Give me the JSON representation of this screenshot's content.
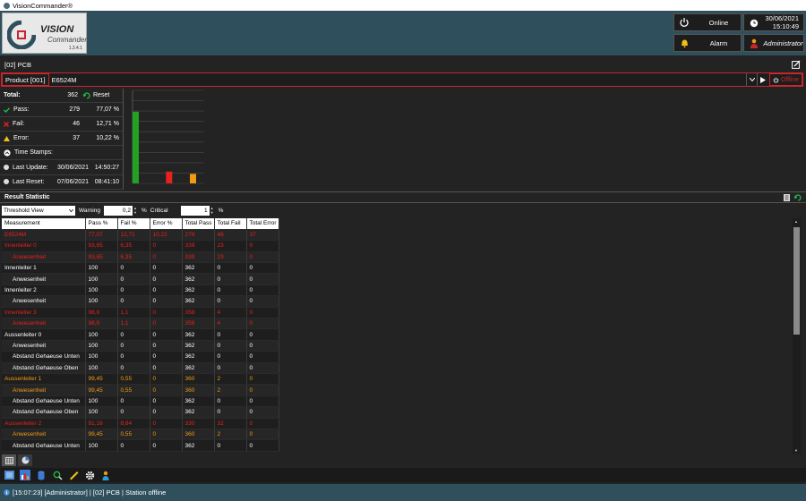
{
  "titlebar": {
    "title": "VisionCommander®"
  },
  "logo": {
    "line1": "VISION",
    "line2": "Commander",
    "version": "1.3.4.1"
  },
  "header": {
    "online_label": "Online",
    "alarm_label": "Alarm",
    "date": "30/06/2021",
    "time": "15:10:49",
    "user": "Administrator"
  },
  "toolbar": {
    "station": "[02] PCB"
  },
  "product": {
    "label": "Product [001]",
    "value": "E6524M",
    "offline_label": "Offline"
  },
  "stats": {
    "total_label": "Total:",
    "total_value": "362",
    "reset_label": "Reset",
    "pass_label": "Pass:",
    "pass_value": "279",
    "pass_pct": "77,07 %",
    "fail_label": "Fail:",
    "fail_value": "46",
    "fail_pct": "12,71 %",
    "error_label": "Error:",
    "error_value": "37",
    "error_pct": "10,22 %",
    "timestamps_label": "Time Stamps:",
    "last_update_label": "Last Update:",
    "last_update_date": "30/06/2021",
    "last_update_time": "14:50:27",
    "last_reset_label": "Last Reset:",
    "last_reset_date": "07/06/2021",
    "last_reset_time": "08:41:10"
  },
  "chart_data": {
    "type": "bar",
    "categories": [
      "Pass",
      "Fail",
      "Error"
    ],
    "values": [
      279,
      46,
      37
    ],
    "colors": [
      "#22a122",
      "#e8201e",
      "#f29b12"
    ],
    "ylim": [
      0,
      362
    ],
    "grid": true
  },
  "result": {
    "title": "Result Statistic",
    "view": "Threshold View",
    "warning_label": "Warning",
    "warning_value": "0,2",
    "critical_label": "Critical",
    "critical_value": "1",
    "pct_sign": "%"
  },
  "table": {
    "headers": [
      "Measurement",
      "Pass %",
      "Fail %",
      "Error %",
      "Total Pass",
      "Total Fail",
      "Total Error"
    ],
    "rows": [
      {
        "indent": false,
        "color": "red",
        "cells": [
          "E6524M",
          "77,07",
          "12,71",
          "10,22",
          "279",
          "46",
          "37"
        ]
      },
      {
        "indent": false,
        "color": "red",
        "cells": [
          "Innenleiter 0",
          "93,65",
          "6,35",
          "0",
          "339",
          "23",
          "0"
        ]
      },
      {
        "indent": true,
        "color": "red",
        "cells": [
          "Anwesenheit",
          "93,65",
          "6,35",
          "0",
          "339",
          "23",
          "0"
        ]
      },
      {
        "indent": false,
        "color": "white",
        "cells": [
          "Innenleiter 1",
          "100",
          "0",
          "0",
          "362",
          "0",
          "0"
        ]
      },
      {
        "indent": true,
        "color": "white",
        "cells": [
          "Anwesenheit",
          "100",
          "0",
          "0",
          "362",
          "0",
          "0"
        ]
      },
      {
        "indent": false,
        "color": "white",
        "cells": [
          "Innenleiter 2",
          "100",
          "0",
          "0",
          "362",
          "0",
          "0"
        ]
      },
      {
        "indent": true,
        "color": "white",
        "cells": [
          "Anwesenheit",
          "100",
          "0",
          "0",
          "362",
          "0",
          "0"
        ]
      },
      {
        "indent": false,
        "color": "red",
        "cells": [
          "Innenleiter 3",
          "98,9",
          "1,1",
          "0",
          "358",
          "4",
          "0"
        ]
      },
      {
        "indent": true,
        "color": "red",
        "cells": [
          "Anwesenheit",
          "98,9",
          "1,1",
          "0",
          "358",
          "4",
          "0"
        ]
      },
      {
        "indent": false,
        "color": "white",
        "cells": [
          "Aussenleiter 0",
          "100",
          "0",
          "0",
          "362",
          "0",
          "0"
        ]
      },
      {
        "indent": true,
        "color": "white",
        "cells": [
          "Anwesenheit",
          "100",
          "0",
          "0",
          "362",
          "0",
          "0"
        ]
      },
      {
        "indent": true,
        "color": "white",
        "cells": [
          "Abstand Gehaeuse Unten",
          "100",
          "0",
          "0",
          "362",
          "0",
          "0"
        ]
      },
      {
        "indent": true,
        "color": "white",
        "cells": [
          "Abstand Gehaeuse Oben",
          "100",
          "0",
          "0",
          "362",
          "0",
          "0"
        ]
      },
      {
        "indent": false,
        "color": "orange",
        "cells": [
          "Aussenleiter 1",
          "99,45",
          "0,55",
          "0",
          "360",
          "2",
          "0"
        ]
      },
      {
        "indent": true,
        "color": "orange",
        "cells": [
          "Anwesenheit",
          "99,45",
          "0,55",
          "0",
          "360",
          "2",
          "0"
        ]
      },
      {
        "indent": true,
        "color": "white",
        "cells": [
          "Abstand Gehaeuse Unten",
          "100",
          "0",
          "0",
          "362",
          "0",
          "0"
        ]
      },
      {
        "indent": true,
        "color": "white",
        "cells": [
          "Abstand Gehaeuse Oben",
          "100",
          "0",
          "0",
          "362",
          "0",
          "0"
        ]
      },
      {
        "indent": false,
        "color": "red",
        "cells": [
          "Aussenleiter 2",
          "91,16",
          "8,84",
          "0",
          "330",
          "32",
          "0"
        ]
      },
      {
        "indent": true,
        "color": "orange",
        "cells": [
          "Anwesenheit",
          "99,45",
          "0,55",
          "0",
          "360",
          "2",
          "0"
        ]
      },
      {
        "indent": true,
        "color": "white",
        "cells": [
          "Abstand Gehaeuse Unten",
          "100",
          "0",
          "0",
          "362",
          "0",
          "0"
        ]
      }
    ]
  },
  "statusbar": {
    "text": "[15:07:23] [Administrator] | [02] PCB | Station offline"
  },
  "colors": {
    "accent": "#c8262d",
    "header_bg": "#2f4f5c",
    "pass": "#22a122",
    "fail": "#e8201e",
    "warn": "#f29b12"
  }
}
